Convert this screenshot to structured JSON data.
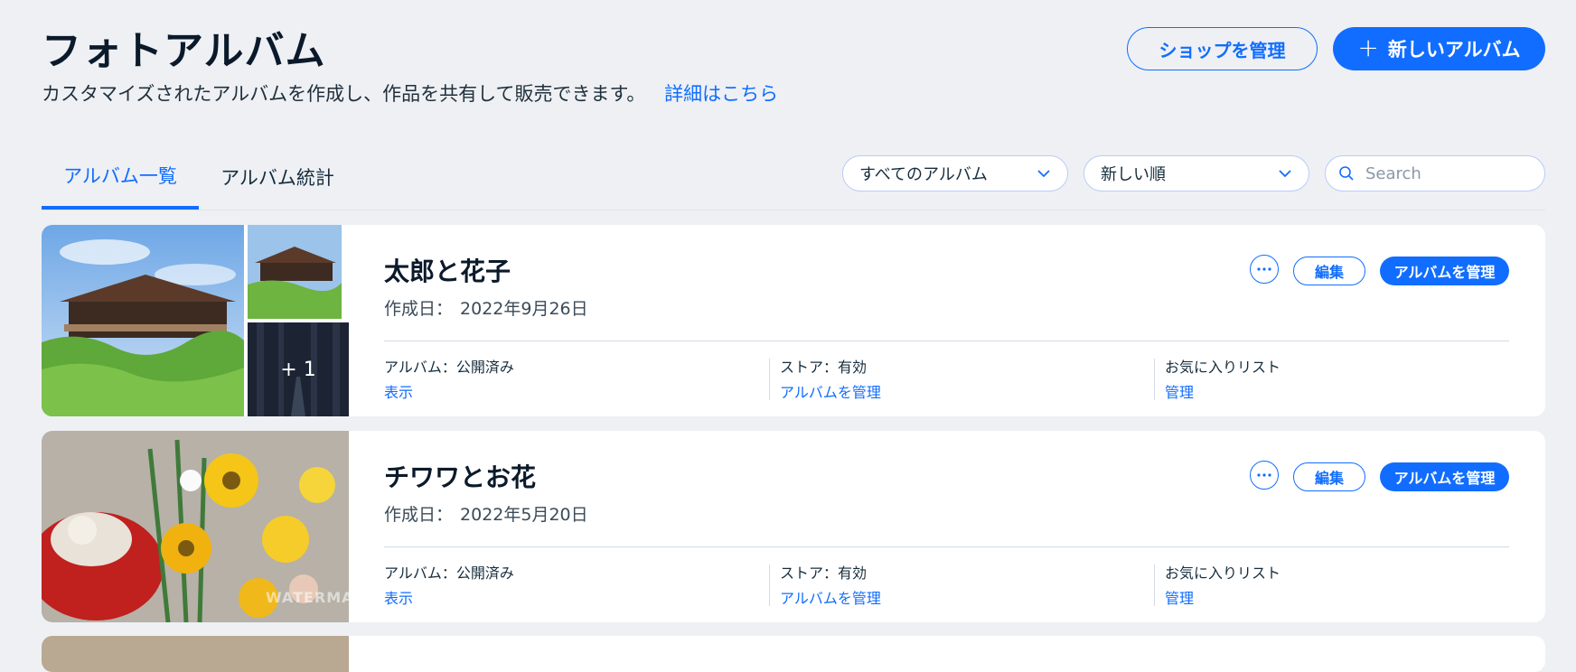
{
  "header": {
    "title": "フォトアルバム",
    "subtitle": "カスタマイズされたアルバムを作成し、作品を共有して販売できます。",
    "learn_more": "詳細はこちら",
    "manage_shop": "ショップを管理",
    "new_album": "新しいアルバム"
  },
  "tabs": [
    {
      "label": "アルバム一覧",
      "active": true
    },
    {
      "label": "アルバム統計",
      "active": false
    }
  ],
  "filters": {
    "album_filter": "すべてのアルバム",
    "sort": "新しい順",
    "search_placeholder": "Search"
  },
  "colors": {
    "accent": "#116dff",
    "background": "#eef0f4",
    "card": "#ffffff"
  },
  "albums": [
    {
      "title": "太郎と花子",
      "date_label": "作成日：",
      "date": "2022年9月26日",
      "more_count": "+ 1",
      "edit": "編集",
      "manage": "アルバムを管理",
      "stats": [
        {
          "label": "アルバム：公開済み",
          "link": "表示"
        },
        {
          "label": "ストア：有効",
          "link": "アルバムを管理"
        },
        {
          "label": "お気に入りリスト",
          "link": "管理"
        }
      ]
    },
    {
      "title": "チワワとお花",
      "date_label": "作成日：",
      "date": "2022年5月20日",
      "edit": "編集",
      "manage": "アルバムを管理",
      "watermark": "WATERMA",
      "stats": [
        {
          "label": "アルバム：公開済み",
          "link": "表示"
        },
        {
          "label": "ストア：有効",
          "link": "アルバムを管理"
        },
        {
          "label": "お気に入りリスト",
          "link": "管理"
        }
      ]
    }
  ]
}
